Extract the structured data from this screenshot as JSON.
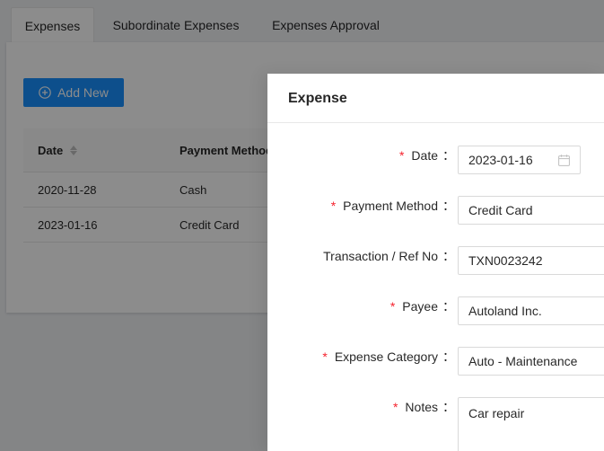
{
  "tabs": [
    {
      "label": "Expenses",
      "active": true
    },
    {
      "label": "Subordinate Expenses",
      "active": false
    },
    {
      "label": "Expenses Approval",
      "active": false
    }
  ],
  "toolbar": {
    "add_label": "Add New"
  },
  "table": {
    "columns": [
      "Date",
      "Payment Method"
    ],
    "rows": [
      {
        "date": "2020-11-28",
        "payment": "Cash"
      },
      {
        "date": "2023-01-16",
        "payment": "Credit Card"
      }
    ]
  },
  "drawer": {
    "title": "Expense",
    "fields": {
      "date": {
        "label": "Date",
        "value": "2023-01-16",
        "required": true
      },
      "payment_method": {
        "label": "Payment Method",
        "value": "Credit Card",
        "required": true
      },
      "transaction_ref": {
        "label": "Transaction / Ref No",
        "value": "TXN0023242",
        "required": false
      },
      "payee": {
        "label": "Payee",
        "value": "Autoland Inc.",
        "required": true
      },
      "expense_category": {
        "label": "Expense Category",
        "value": "Auto - Maintenance",
        "required": true
      },
      "notes": {
        "label": "Notes",
        "value": "Car repair",
        "required": true
      }
    },
    "colon": "：",
    "required_mark": "*"
  },
  "colors": {
    "primary": "#1890ff",
    "required": "#f5222d",
    "mask": "rgba(0,0,0,0.45)"
  },
  "icons": {
    "add": "plus-circle-icon",
    "calendar": "calendar-icon",
    "sort": "sort-caret-icon"
  }
}
